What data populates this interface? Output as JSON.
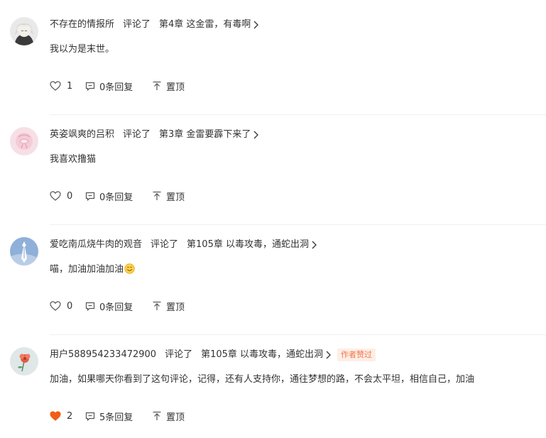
{
  "comments": [
    {
      "user": "不存在的情报所",
      "action": "评论了",
      "chapter": "第4章 这金雷，有毒啊",
      "badge": "",
      "content": "我以为是末世。",
      "likes": "1",
      "liked": false,
      "replies": "0条回复",
      "pin": "置顶"
    },
    {
      "user": "英姿飒爽的吕积",
      "action": "评论了",
      "chapter": "第3章 金雷要霹下来了",
      "badge": "",
      "content": "我喜欢撸猫",
      "likes": "0",
      "liked": false,
      "replies": "0条回复",
      "pin": "置顶"
    },
    {
      "user": "爱吃南瓜烧牛肉的观音",
      "action": "评论了",
      "chapter": "第105章 以毒攻毒，通蛇出洞",
      "badge": "",
      "content": "喵，加油加油加油",
      "likes": "0",
      "liked": false,
      "replies": "0条回复",
      "pin": "置顶"
    },
    {
      "user": "用户588954233472900",
      "action": "评论了",
      "chapter": "第105章 以毒攻毒，通蛇出洞",
      "badge": "作者赞过",
      "content": "加油，如果哪天你看到了这句评论，记得，还有人支持你，通往梦想的路，不会太平坦，相信自己，加油",
      "likes": "2",
      "liked": true,
      "replies": "5条回复",
      "pin": "置顶"
    }
  ],
  "colors": {
    "text": "#333333",
    "icon": "#555555",
    "liked": "#f25c19",
    "badge_bg": "#fdeee6",
    "badge_text": "#f2764a",
    "divider": "#f0f0f0"
  },
  "icons": {
    "like": "heart-icon",
    "reply": "comment-icon",
    "pin": "pin-top-icon",
    "chapter_link": "chevron-right-icon",
    "emoji": "smile-emoji-icon"
  }
}
